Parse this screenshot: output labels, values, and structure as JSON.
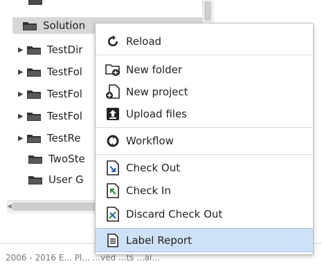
{
  "tree": {
    "top_partial_label": "",
    "items": [
      {
        "label": "Solution",
        "expandable": false,
        "selected": true
      },
      {
        "label": "TestDir",
        "expandable": true,
        "selected": false
      },
      {
        "label": "TestFol",
        "expandable": true,
        "selected": false
      },
      {
        "label": "TestFol",
        "expandable": true,
        "selected": false
      },
      {
        "label": "TestFol",
        "expandable": true,
        "selected": false
      },
      {
        "label": "TestRe",
        "expandable": true,
        "selected": false
      },
      {
        "label": "TwoSte",
        "expandable": false,
        "selected": false
      },
      {
        "label": "User G",
        "expandable": false,
        "selected": false
      }
    ]
  },
  "context_menu": {
    "items": [
      {
        "label": "Reload",
        "icon": "reload-icon"
      },
      {
        "label": "New folder",
        "icon": "new-folder-icon"
      },
      {
        "label": "New project",
        "icon": "new-project-icon"
      },
      {
        "label": "Upload files",
        "icon": "upload-icon"
      },
      {
        "label": "Workflow",
        "icon": "workflow-icon"
      },
      {
        "label": "Check Out",
        "icon": "check-out-icon"
      },
      {
        "label": "Check In",
        "icon": "check-in-icon"
      },
      {
        "label": "Discard Check Out",
        "icon": "discard-check-out-icon"
      },
      {
        "label": "Label Report",
        "icon": "label-report-icon",
        "highlighted": true
      }
    ]
  },
  "footer": {
    "text": "2006 - 2016 E... Pl... ...ved ...ts ...al..."
  },
  "colors": {
    "highlight": "#cde2f7",
    "selected_row": "#d7d7d7"
  }
}
